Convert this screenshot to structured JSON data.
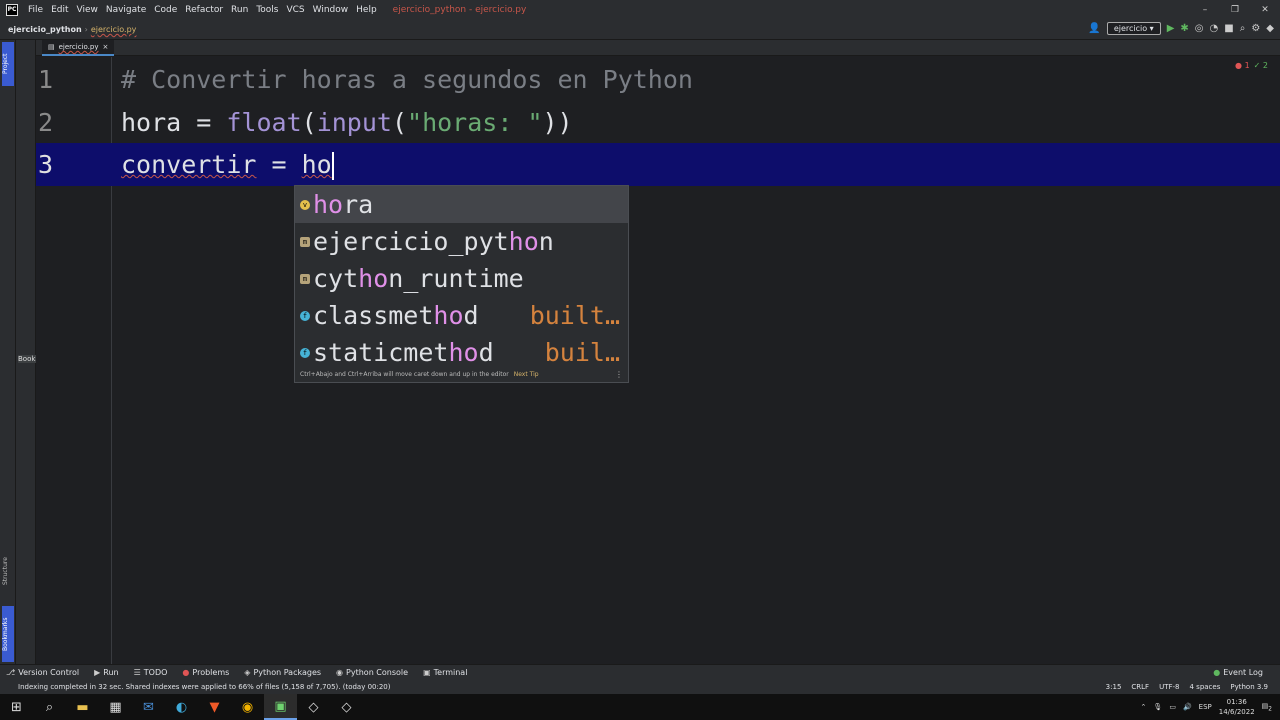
{
  "titlebar": {
    "menu": [
      "File",
      "Edit",
      "View",
      "Navigate",
      "Code",
      "Refactor",
      "Run",
      "Tools",
      "VCS",
      "Window",
      "Help"
    ],
    "title": "ejercicio_python - ejercicio.py"
  },
  "navbar": {
    "project": "ejercicio_python",
    "file": "ejercicio.py",
    "run_config": "ejercicio"
  },
  "side_tabs": {
    "project": "Project",
    "structure": "Structure",
    "bookmarks": "Bookmarks",
    "bookmarks_short": "Book"
  },
  "editor_tab": {
    "name": "ejercicio.py"
  },
  "inspections": {
    "errors": "1",
    "warnings": "2"
  },
  "code": {
    "lines": [
      {
        "num": "1",
        "comment": "# Convertir horas a segundos en Python"
      },
      {
        "num": "2",
        "var": "hora",
        "eq": " = ",
        "fn1": "float",
        "p1": "(",
        "fn2": "input",
        "p2": "(",
        "str": "\"horas: \"",
        "p3": "))"
      },
      {
        "num": "3",
        "var": "convertir",
        "eq": " = ",
        "typed": "ho"
      }
    ]
  },
  "completion": {
    "items": [
      {
        "pre": "",
        "hl": "ho",
        "post": "ra",
        "kind": "v",
        "tail": ""
      },
      {
        "pre": "ejercicio_pyt",
        "hl": "ho",
        "post": "n",
        "kind": "m",
        "tail": ""
      },
      {
        "pre": "cyt",
        "hl": "ho",
        "post": "n_runtime",
        "kind": "m",
        "tail": ""
      },
      {
        "pre": "classmet",
        "hl": "ho",
        "post": "d",
        "kind": "f",
        "tail": "built…"
      },
      {
        "pre": "staticmet",
        "hl": "ho",
        "post": "d",
        "kind": "f",
        "tail": "buil…"
      }
    ],
    "footer": "Ctrl+Abajo and Ctrl+Arriba will move caret down and up in the editor",
    "next_tip": "Next Tip"
  },
  "tool_windows": [
    "Version Control",
    "Run",
    "TODO",
    "Problems",
    "Python Packages",
    "Python Console",
    "Terminal"
  ],
  "event_log": "Event Log",
  "status": {
    "message": "Indexing completed in 32 sec. Shared indexes were applied to 66% of files (5,158 of 7,705). (today 00:20)",
    "position": "3:15",
    "line_sep": "CRLF",
    "encoding": "UTF-8",
    "indent": "4 spaces",
    "interpreter": "Python 3.9"
  },
  "tray": {
    "lang": "ESP",
    "time": "01:36",
    "date": "14/6/2022",
    "notif": "2"
  }
}
